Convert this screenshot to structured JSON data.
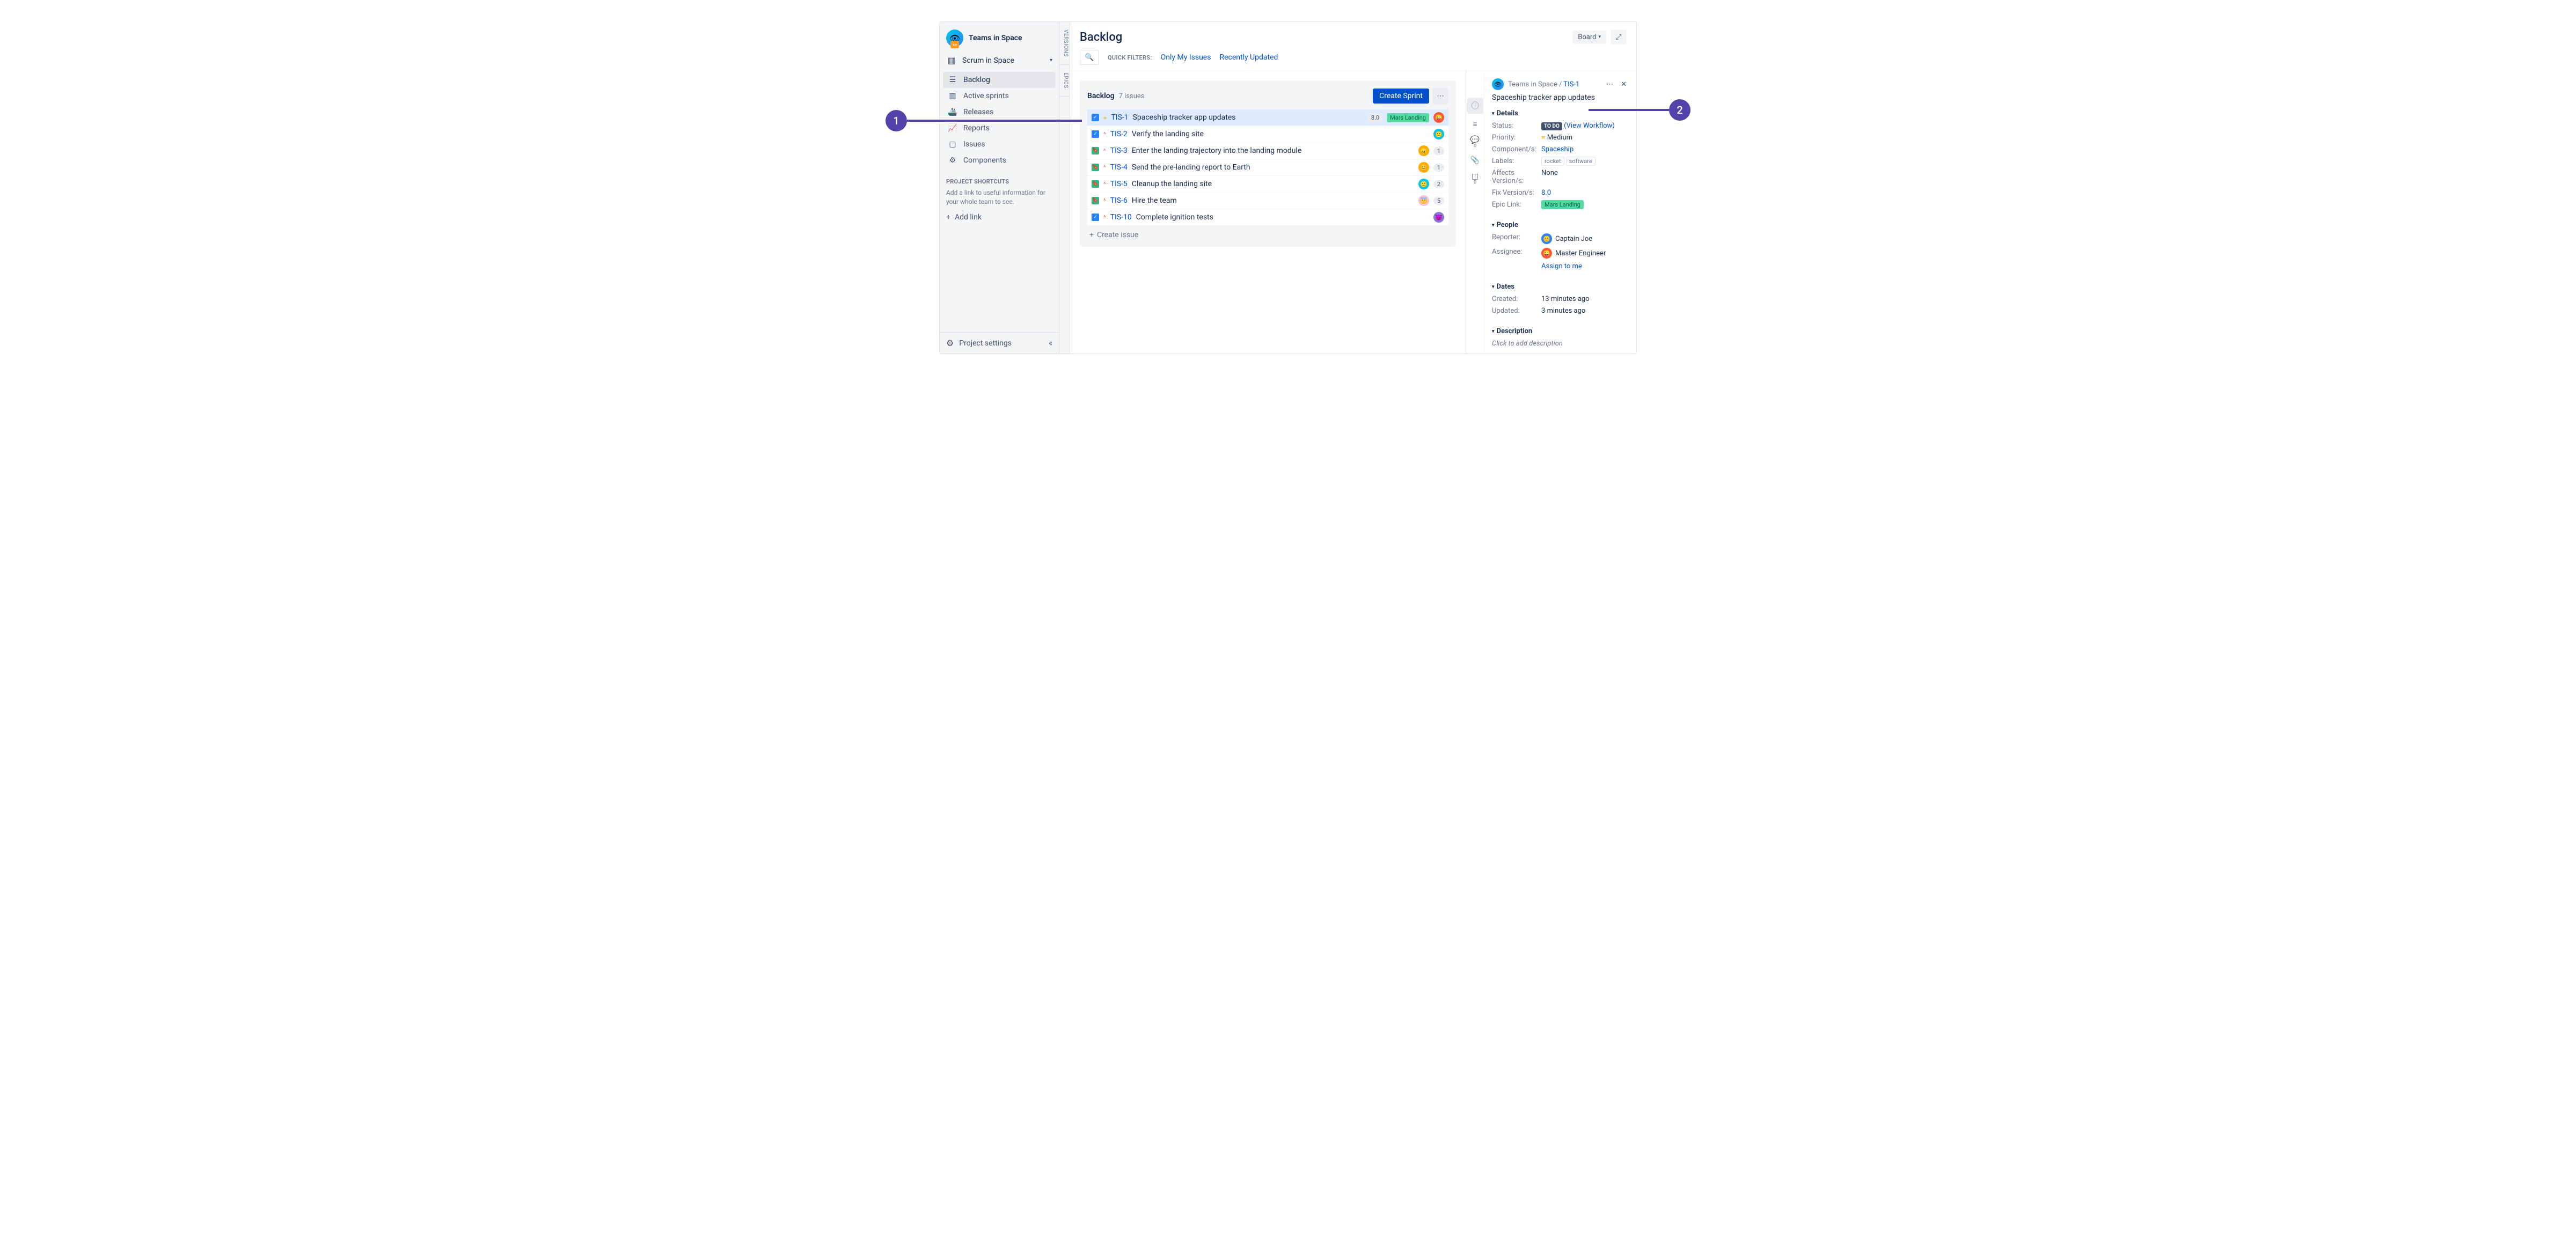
{
  "annotations": {
    "one": "1",
    "two": "2"
  },
  "project": {
    "name": "Teams in Space",
    "board": "Scrum in Space"
  },
  "sidebar": {
    "items": [
      {
        "label": "Backlog",
        "active": true
      },
      {
        "label": "Active sprints"
      },
      {
        "label": "Releases"
      },
      {
        "label": "Reports"
      },
      {
        "label": "Issues"
      },
      {
        "label": "Components"
      }
    ],
    "shortcuts_title": "PROJECT SHORTCUTS",
    "shortcuts_desc": "Add a link to useful information for your whole team to see.",
    "add_link": "Add link",
    "settings": "Project settings"
  },
  "vertical_tabs": {
    "versions": "VERSIONS",
    "epics": "EPICS"
  },
  "header": {
    "title": "Backlog",
    "board_btn": "Board",
    "quick_filters_label": "QUICK FILTERS:",
    "filters": [
      "Only My Issues",
      "Recently Updated"
    ]
  },
  "backlog": {
    "title": "Backlog",
    "count": "7 issues",
    "create_sprint": "Create Sprint",
    "create_issue": "Create issue",
    "issues": [
      {
        "type": "task",
        "priority": "medium",
        "key": "TIS-1",
        "summary": "Spaceship tracker app updates",
        "version": "8.0",
        "epic": "Mars Landing",
        "avatar_bg": "#ff5630",
        "avatar_emoji": "😜",
        "selected": true
      },
      {
        "type": "task",
        "priority": "high",
        "key": "TIS-2",
        "summary": "Verify the landing site",
        "avatar_bg": "#00c7e6",
        "avatar_emoji": "🙂"
      },
      {
        "type": "story",
        "priority": "high",
        "key": "TIS-3",
        "summary": "Enter the landing trajectory into the landing module",
        "avatar_bg": "#ffab00",
        "avatar_emoji": "😠",
        "count": "1"
      },
      {
        "type": "story",
        "priority": "high",
        "key": "TIS-4",
        "summary": "Send the pre-landing report to Earth",
        "avatar_bg": "#ffab00",
        "avatar_emoji": "😊",
        "count": "1"
      },
      {
        "type": "story",
        "priority": "high",
        "key": "TIS-5",
        "summary": "Cleanup the landing site",
        "avatar_bg": "#00c7e6",
        "avatar_emoji": "🙂",
        "count": "2"
      },
      {
        "type": "story",
        "priority": "high",
        "key": "TIS-6",
        "summary": "Hire the team",
        "avatar_bg": "#ffc0cb",
        "avatar_emoji": "😇",
        "count": "5"
      },
      {
        "type": "task",
        "priority": "high",
        "key": "TIS-10",
        "summary": "Complete ignition tests",
        "avatar_bg": "#8777d9",
        "avatar_emoji": "😈"
      }
    ]
  },
  "detail": {
    "project": "Teams in Space",
    "key": "TIS-1",
    "title": "Spaceship tracker app updates",
    "sections": {
      "details": "Details",
      "people": "People",
      "dates": "Dates",
      "description": "Description"
    },
    "fields": {
      "status_label": "Status:",
      "status_value": "TO DO",
      "workflow": "(View Workflow)",
      "priority_label": "Priority:",
      "priority_value": "Medium",
      "components_label": "Component/s:",
      "components_value": "Spaceship",
      "labels_label": "Labels:",
      "labels": [
        "rocket",
        "software"
      ],
      "affects_label": "Affects Version/s:",
      "affects_value": "None",
      "fix_label": "Fix Version/s:",
      "fix_value": "8.0",
      "epic_label": "Epic Link:",
      "epic_value": "Mars Landing",
      "reporter_label": "Reporter:",
      "reporter_value": "Captain Joe",
      "assignee_label": "Assignee:",
      "assignee_value": "Master Engineer",
      "assign_to_me": "Assign to me",
      "created_label": "Created:",
      "created_value": "13 minutes ago",
      "updated_label": "Updated:",
      "updated_value": "3 minutes ago",
      "desc_placeholder": "Click to add description"
    },
    "tab_counts": {
      "comments": "0",
      "subtasks": "0"
    }
  }
}
